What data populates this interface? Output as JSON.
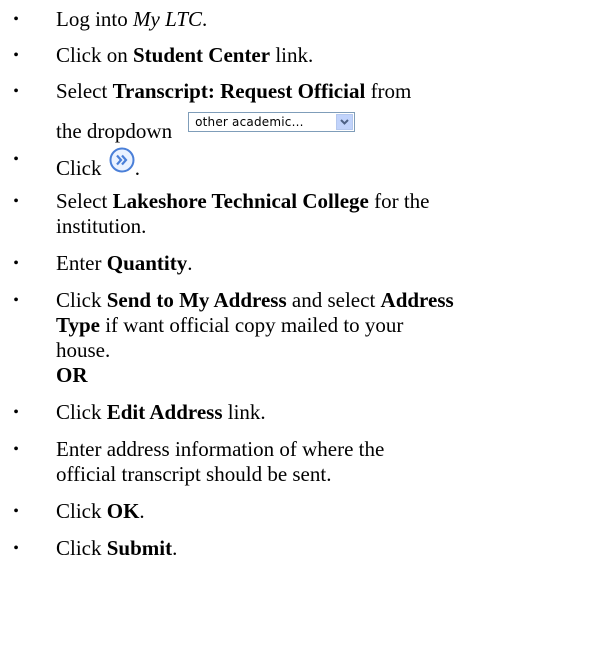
{
  "steps": {
    "s1": {
      "pre": "Log into ",
      "em": "My LTC",
      "post": "."
    },
    "s2": {
      "pre": "Click on ",
      "bold": "Student Center",
      "post": " link."
    },
    "s3": {
      "pre": "Select ",
      "bold": "Transcript: Request Official",
      "post": " from",
      "line2": "the dropdown",
      "dropdown_value": "other academic..."
    },
    "s4": {
      "pre": "Click ",
      "post": "."
    },
    "s5": {
      "pre": "Select ",
      "bold": "Lakeshore Technical College",
      "post": " for the",
      "line2": "institution."
    },
    "s6": {
      "pre": "Enter ",
      "bold": "Quantity",
      "post": "."
    },
    "s7": {
      "pre": "Click ",
      "bold1": "Send to My Address",
      "mid": " and select ",
      "bold2": "Address",
      "bold3": "Type",
      "post": " if want official copy mailed to your",
      "line3": "house.",
      "or": "OR"
    },
    "s8": {
      "pre": "Click ",
      "bold": "Edit Address",
      "post": " link."
    },
    "s9": {
      "line1": "Enter address information of where the",
      "line2": "official transcript should be sent."
    },
    "s10": {
      "pre": "Click ",
      "bold": "OK",
      "post": "."
    },
    "s11": {
      "pre": "Click ",
      "bold": "Submit",
      "post": "."
    }
  },
  "bullet_char": "•",
  "icons": {
    "dropdown_arrow": "chevron-down-icon",
    "go_button": "double-chevron-right-icon"
  },
  "colors": {
    "widget_border": "#7f9db9",
    "widget_button": "#c1d3fb",
    "go_icon": "#4a7fd8"
  }
}
